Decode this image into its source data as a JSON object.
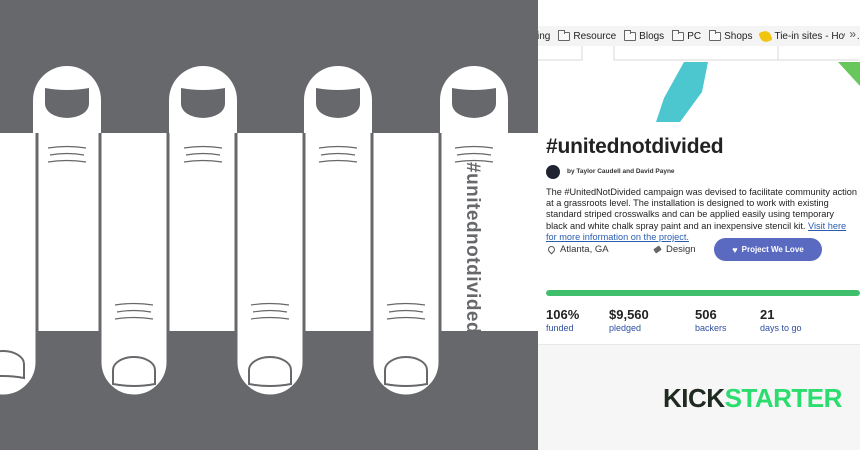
{
  "artwork": {
    "hashtag": "#unitednotdivided",
    "background": "#67686b",
    "stripe_color": "#ffffff"
  },
  "browser": {
    "bookmarks": [
      {
        "label": "ing",
        "icon": "none"
      },
      {
        "label": "Resource",
        "icon": "folder-icon"
      },
      {
        "label": "Blogs",
        "icon": "folder-icon"
      },
      {
        "label": "PC",
        "icon": "folder-icon"
      },
      {
        "label": "Shops",
        "icon": "folder-icon"
      },
      {
        "label": "Tie-in sites - How I...",
        "icon": "tie-icon"
      }
    ],
    "more": "»"
  },
  "project": {
    "title": "#unitednotdivided",
    "byline": "by Taylor Caudell and David Payne",
    "description": "The #UnitedNotDivided campaign was devised to facilitate community action at a grassroots level. The installation is designed to work with existing standard striped crosswalks and can be applied easily using temporary black and white chalk spray paint and an inexpensive stencil kit.",
    "link_text": "Visit here for more information on the project.",
    "location": "Atlanta, GA",
    "category": "Design",
    "badge": "Project We Love",
    "accent_color": "#5a6ac0",
    "progress_fraction": 1.0,
    "progress_color": "#3fbf6b",
    "stats": [
      {
        "value": "106%",
        "label": "funded"
      },
      {
        "value": "$9,560",
        "label": "pledged"
      },
      {
        "value": "506",
        "label": "backers"
      },
      {
        "value": "21",
        "label": "days to go"
      }
    ]
  },
  "brand": {
    "part1": "KICK",
    "part2": "STARTER",
    "color_dark": "#1f2a20",
    "color_green": "#2bdd6e"
  }
}
